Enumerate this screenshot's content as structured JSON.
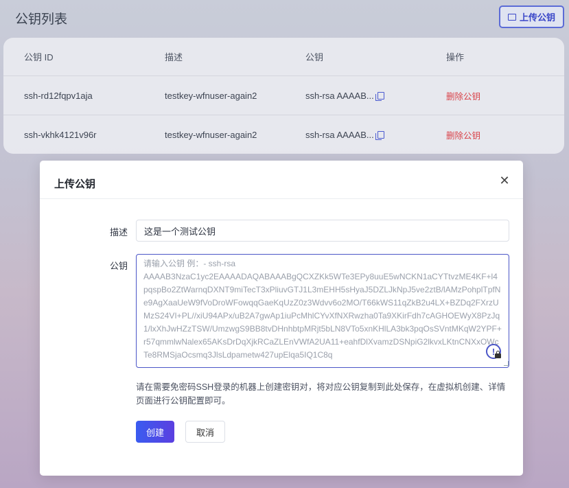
{
  "page": {
    "title": "公钥列表",
    "upload_button": "上传公钥"
  },
  "table": {
    "headers": [
      "公钥 ID",
      "描述",
      "公钥",
      "操作"
    ],
    "rows": [
      {
        "id": "ssh-rd12fqpv1aja",
        "description": "testkey-wfnuser-again2",
        "key": "ssh-rsa AAAAB...",
        "action": "删除公钥"
      },
      {
        "id": "ssh-vkhk4121v96r",
        "description": "testkey-wfnuser-again2",
        "key": "ssh-rsa AAAAB...",
        "action": "删除公钥"
      }
    ]
  },
  "modal": {
    "title": "上传公钥",
    "close_icon": "close-icon",
    "desc_label": "描述",
    "desc_value": "这是一个测试公钥",
    "key_label": "公钥",
    "key_placeholder": "请输入公钥 例：- ssh-rsa\nAAAAB3NzaC1yc2EAAAADAQABAAABgQCXZKk5WTe3EPy8uuE5wNCKN1aCYTtvzME4KF+l4pqspBo2ZtWarnqDXNT9miTecT3xPliuvGTJ1L3mEHH5sHyaJ5DZLJkNpJ5ve2ztB/lAMzPohplTpfNe9AgXaaUeW9fVoDroWFowqqGaeKqUzZ0z3Wdvv6o2MO/T66kWS11qZkB2u4LX+BZDq2FXrzUMzS24VI+PL//xiU94APx/uB2A7gwAp1iuPcMhlCYvXfNXRwzha0Ta9XKirFdh7cAGHOEWyX8PzJq1/lxXhJwHZzTSW/UmzwgS9BB8tvDHnhbtpMRjt5bLN8VTo5xnKHlLA3bk3pqOsSVntMKqW2YPF+r57qmmlwNalex65AKsDrDqXjkRCaZLEnVWfA2UA11+eahfDlXvamzDSNpiG2lkvxLKtnCNXxOWcTe8RMSjaOcsmq3JlsLdpametw427upElqa5IQ1C8q",
    "hint": "请在需要免密码SSH登录的机器上创建密钥对，将对应公钥复制到此处保存，在虚拟机创建、详情页面进行公钥配置即可。",
    "create_button": "创建",
    "cancel_button": "取消"
  },
  "colors": {
    "primary": "#3a5cf0",
    "danger": "#d9434a"
  }
}
